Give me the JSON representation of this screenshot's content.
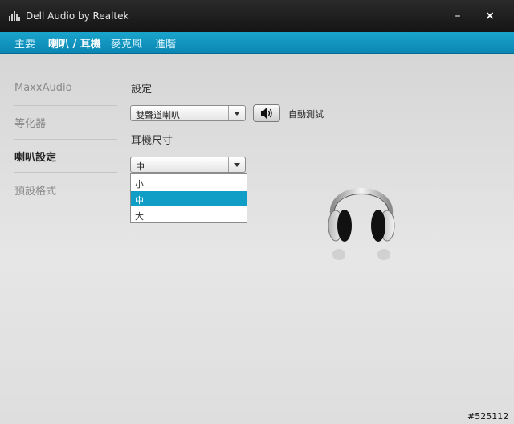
{
  "window": {
    "title": "Dell Audio by Realtek",
    "minimize_glyph": "–",
    "close_glyph": "×"
  },
  "tabs": [
    {
      "label": "主要",
      "active": false
    },
    {
      "label": "喇叭 / 耳機",
      "active": true
    },
    {
      "label": "麥克風",
      "active": false
    },
    {
      "label": "進階",
      "active": false
    }
  ],
  "sidebar": {
    "items": [
      {
        "label": "MaxxAudio",
        "active": false
      },
      {
        "label": "等化器",
        "active": false
      },
      {
        "label": "喇叭設定",
        "active": true
      },
      {
        "label": "預設格式",
        "active": false
      }
    ]
  },
  "settings": {
    "label": "設定",
    "speaker_select_value": "雙聲道喇叭",
    "test_label": "自動測試",
    "speaker_icon": "speaker-icon"
  },
  "headphone_size": {
    "label": "耳機尺寸",
    "selected": "中",
    "options": [
      "小",
      "中",
      "大"
    ],
    "highlighted_index": 1
  },
  "watermark": "#525112",
  "colors": {
    "accent": "#109dc6",
    "titlebar": "#1b1b1b"
  }
}
